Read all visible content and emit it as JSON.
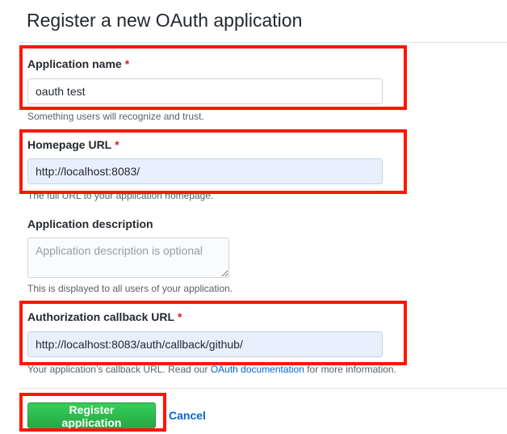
{
  "page": {
    "title": "Register a new OAuth application"
  },
  "form": {
    "app_name": {
      "label": "Application name",
      "required_mark": "*",
      "value": "oauth test",
      "note": "Something users will recognize and trust."
    },
    "homepage_url": {
      "label": "Homepage URL",
      "required_mark": "*",
      "value": "http://localhost:8083/",
      "note": "The full URL to your application homepage."
    },
    "description": {
      "label": "Application description",
      "placeholder": "Application description is optional",
      "note": "This is displayed to all users of your application."
    },
    "callback_url": {
      "label": "Authorization callback URL",
      "required_mark": "*",
      "value": "http://localhost:8083/auth/callback/github/",
      "note_prefix": "Your application’s callback URL. Read our ",
      "note_link": "OAuth documentation",
      "note_suffix": " for more information."
    }
  },
  "actions": {
    "register_label": "Register application",
    "cancel_label": "Cancel"
  },
  "colors": {
    "highlight": "#ff1500",
    "primary_button": "#28a745",
    "link": "#0366d6",
    "required": "#cb2431",
    "autofill_bg": "#e8f0fe"
  }
}
